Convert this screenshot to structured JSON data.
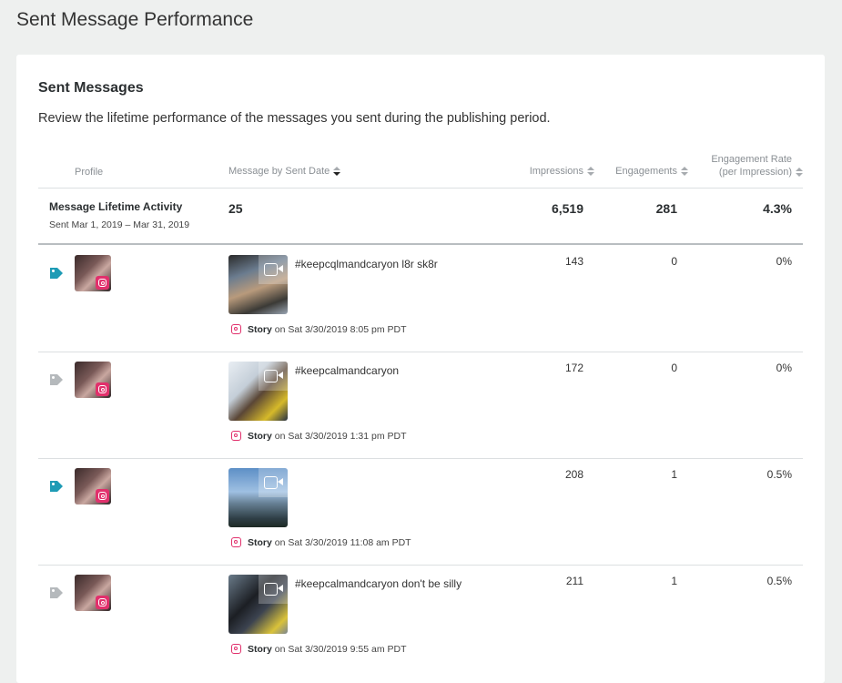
{
  "page_title": "Sent Message Performance",
  "card": {
    "title": "Sent Messages",
    "description": "Review the lifetime performance of the messages you sent during the publishing period."
  },
  "columns": {
    "profile": "Profile",
    "message": "Message by Sent Date",
    "impressions": "Impressions",
    "engagements": "Engagements",
    "engagement_rate_line1": "Engagement Rate",
    "engagement_rate_line2": "(per Impression)"
  },
  "summary": {
    "label": "Message Lifetime Activity",
    "sub": "Sent Mar 1, 2019 – Mar 31, 2019",
    "messages": "25",
    "impressions": "6,519",
    "engagements": "281",
    "engagement_rate": "4.3%"
  },
  "colors": {
    "tag_active": "#1e9bb5",
    "tag_inactive": "#b5b9bc",
    "instagram": "#e1306c"
  },
  "rows": [
    {
      "tag_active": true,
      "text": "#keepcqlmandcaryon l8r sk8r",
      "type": "Story",
      "sent": " on Sat 3/30/2019 8:05 pm PDT",
      "impressions": "143",
      "engagements": "0",
      "engagement_rate": "0%"
    },
    {
      "tag_active": false,
      "text": "#keepcalmandcaryon",
      "type": "Story",
      "sent": " on Sat 3/30/2019 1:31 pm PDT",
      "impressions": "172",
      "engagements": "0",
      "engagement_rate": "0%"
    },
    {
      "tag_active": true,
      "text": "",
      "type": "Story",
      "sent": " on Sat 3/30/2019 11:08 am PDT",
      "impressions": "208",
      "engagements": "1",
      "engagement_rate": "0.5%"
    },
    {
      "tag_active": false,
      "text": "#keepcalmandcaryon don't be silly",
      "type": "Story",
      "sent": " on Sat 3/30/2019 9:55 am PDT",
      "impressions": "211",
      "engagements": "1",
      "engagement_rate": "0.5%"
    }
  ]
}
